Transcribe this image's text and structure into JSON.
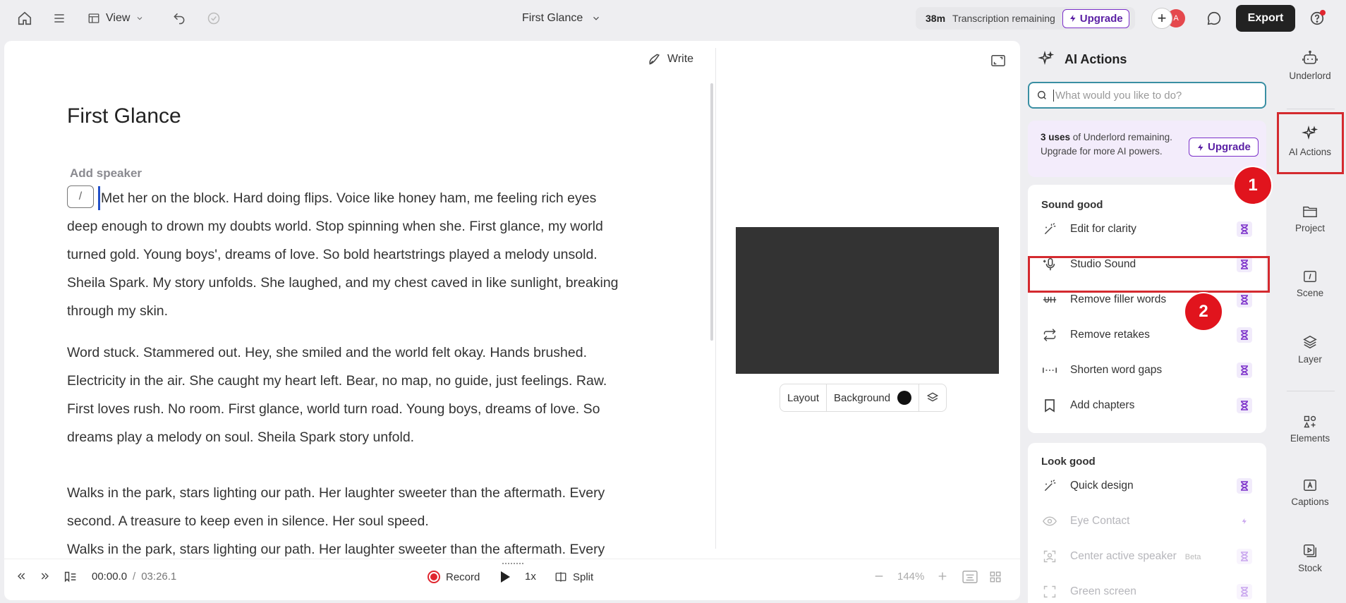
{
  "topbar": {
    "view_label": "View",
    "doc_title": "First Glance",
    "transcription_time": "38m",
    "transcription_label": "Transcription remaining",
    "upgrade_label": "Upgrade",
    "avatar_initial": "A",
    "export_label": "Export"
  },
  "editor": {
    "write_label": "Write",
    "title": "First Glance",
    "add_speaker": "Add speaker",
    "slash": "/",
    "paragraphs": [
      [
        "Met her on the block. Hard doing flips. Voice like honey ham, me feeling rich eyes",
        "deep enough to drown my doubts world. Stop spinning when she. First glance, my world",
        "turned gold. Young boys', dreams of love. So bold heartstrings played a melody unsold.",
        "Sheila Spark. My story unfolds. She laughed, and my chest caved in like sunlight, breaking",
        "through my skin."
      ],
      [
        "Word stuck. Stammered out. Hey, she smiled and the world felt okay. Hands brushed.",
        "Electricity in the air. She caught my heart left. Bear, no map, no guide, just feelings. Raw.",
        "First loves rush. No room. First glance, world turn road. Young boys, dreams of love. So",
        "dreams play a melody on soul. Sheila Spark story unfold."
      ],
      [
        "Walks in the park, stars lighting our path. Her laughter sweeter than the aftermath. Every",
        "second. A treasure to keep even in silence. Her soul speed."
      ],
      [
        "Walks in the park, stars lighting our path. Her laughter sweeter than the aftermath. Every"
      ]
    ],
    "layout_label": "Layout",
    "background_label": "Background",
    "background_color": "#111111"
  },
  "bottom": {
    "current_time": "00:00.0",
    "separator": "/",
    "total_time": "03:26.1",
    "record_label": "Record",
    "speed": "1x",
    "split_label": "Split",
    "zoom": "144%"
  },
  "ai_panel": {
    "title": "AI Actions",
    "search_placeholder": "What would you like to do?",
    "promo_bold": "3 uses",
    "promo_rest": " of Underlord remaining. Upgrade for more AI powers.",
    "promo_upgrade": "Upgrade",
    "sections": [
      {
        "title": "Sound good",
        "actions": [
          {
            "label": "Edit for clarity",
            "icon": "wand-icon",
            "badge": "hourglass"
          },
          {
            "label": "Studio Sound",
            "icon": "microphone-sparkle-icon",
            "badge": "hourglass"
          },
          {
            "label": "Remove filler words",
            "icon": "strikethrough-uh-icon",
            "badge": "hourglass"
          },
          {
            "label": "Remove retakes",
            "icon": "repeat-icon",
            "badge": "hourglass"
          },
          {
            "label": "Shorten word gaps",
            "icon": "word-gap-icon",
            "badge": "hourglass"
          },
          {
            "label": "Add chapters",
            "icon": "bookmark-icon",
            "badge": "hourglass"
          }
        ]
      },
      {
        "title": "Look good",
        "actions": [
          {
            "label": "Quick design",
            "icon": "wand-icon",
            "badge": "hourglass"
          },
          {
            "label": "Eye Contact",
            "icon": "eye-icon",
            "badge": "lightning"
          },
          {
            "label": "Center active speaker",
            "icon": "center-frame-icon",
            "badge": "hourglass",
            "tag": "Beta"
          },
          {
            "label": "Green screen",
            "icon": "person-frame-icon",
            "badge": "hourglass"
          }
        ]
      }
    ]
  },
  "rail": {
    "items": [
      "Underlord",
      "AI Actions",
      "Project",
      "Scene",
      "Layer",
      "Elements",
      "Captions",
      "Stock"
    ]
  },
  "annotations": {
    "badge_1": "1",
    "badge_2": "2",
    "color": "#d42a2f"
  }
}
